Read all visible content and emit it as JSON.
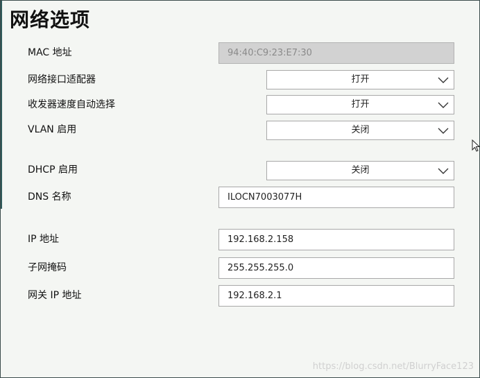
{
  "title": "网络选项",
  "fields": {
    "mac": {
      "label": "MAC 地址",
      "value": "94:40:C9:23:E7:30"
    },
    "nic": {
      "label": "网络接口适配器",
      "value": "打开"
    },
    "transceiver": {
      "label": "收发器速度自动选择",
      "value": "打开"
    },
    "vlan": {
      "label": "VLAN 启用",
      "value": "关闭"
    },
    "dhcp": {
      "label": "DHCP 启用",
      "value": "关闭"
    },
    "dns": {
      "label": "DNS 名称",
      "value": "ILOCN7003077H"
    },
    "ip": {
      "label": "IP 地址",
      "value": "192.168.2.158"
    },
    "subnet": {
      "label": "子网掩码",
      "value": "255.255.255.0"
    },
    "gateway": {
      "label": "网关 IP 地址",
      "value": "192.168.2.1"
    }
  },
  "watermark": "https://blog.csdn.net/BlurryFace123",
  "icons": {
    "dropdown": "chevron-down-icon",
    "cursor": "mouse-pointer-icon"
  },
  "colors": {
    "background": "#f4f6f3",
    "disabled_field": "#d2d2d2",
    "border": "#a8a8a8",
    "accent_strip": "#2f5a5a"
  }
}
